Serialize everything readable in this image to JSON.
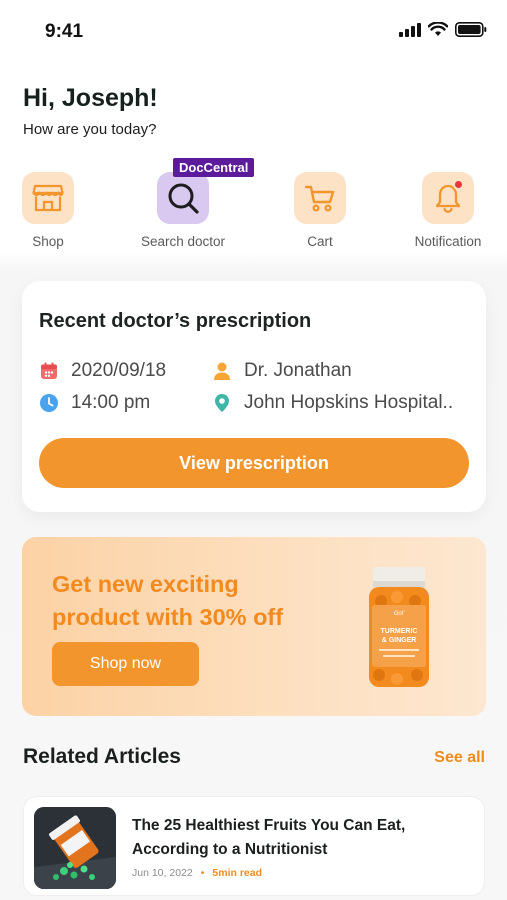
{
  "status_bar": {
    "time": "9:41"
  },
  "header": {
    "greeting": "Hi, Joseph!",
    "subtitle": "How are you today?"
  },
  "quick_actions": [
    {
      "label": "Shop",
      "icon": "store-icon"
    },
    {
      "label": "Search doctor",
      "icon": "search-icon",
      "badge": "DocCentral"
    },
    {
      "label": "Cart",
      "icon": "cart-icon"
    },
    {
      "label": "Notification",
      "icon": "bell-icon",
      "has_dot": true
    }
  ],
  "prescription": {
    "title": "Recent doctor’s prescription",
    "date": "2020/09/18",
    "time": "14:00 pm",
    "doctor": "Dr. Jonathan",
    "hospital": "John Hopskins Hospital..",
    "button_label": "View prescription"
  },
  "promo": {
    "line1": "Get new exciting",
    "line2": "product with 30% off",
    "button_label": "Shop now",
    "product_label_1": "TURMERIC",
    "product_label_2": "& GINGER"
  },
  "articles_section": {
    "title": "Related Articles",
    "see_all": "See all",
    "items": [
      {
        "title_line1": "The 25 Healthiest Fruits You Can Eat,",
        "title_line2": "According to a Nutritionist",
        "date": "Jun 10, 2022",
        "read_time": "5min read"
      }
    ]
  },
  "colors": {
    "accent": "#f3952d",
    "accent_text": "#f08c1f",
    "icon_bg": "#fde2c6",
    "search_bg": "#d9c8f0",
    "badge_bg": "#5b1b9b"
  }
}
